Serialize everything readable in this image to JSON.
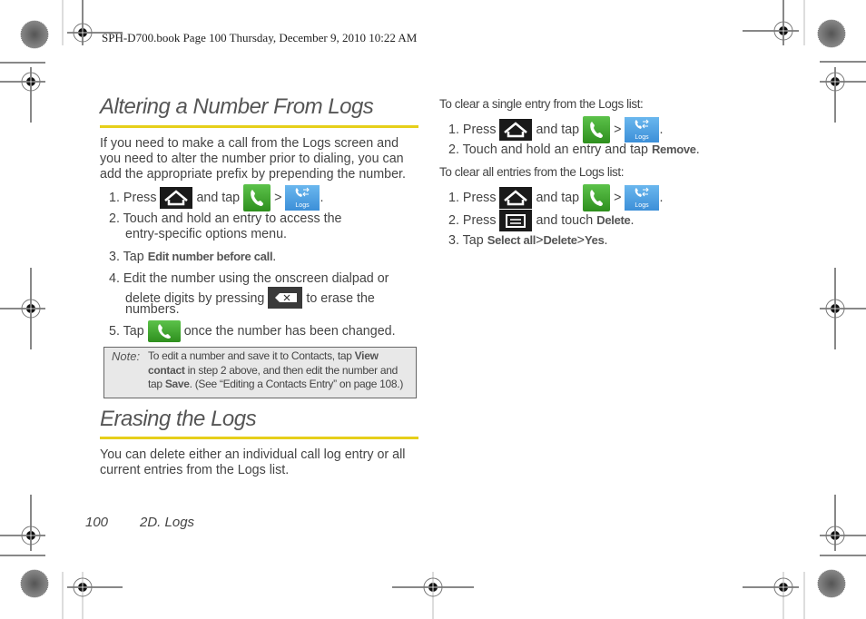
{
  "slug": "SPH-D700.book  Page 100  Thursday, December 9, 2010  10:22 AM",
  "left": {
    "section1": {
      "title": "Altering a Number From Logs",
      "intro": "If you need to make a call from the Logs screen and you need to alter the number prior to dialing, you can add the appropriate prefix by prepending the number.",
      "steps": [
        {
          "num": "1.",
          "pre": "Press",
          "mid": "and tap",
          "sep": ">",
          "end": "."
        },
        {
          "num": "2.",
          "line1": "Touch and hold an entry to access the",
          "line2": "entry-specific options menu."
        },
        {
          "num": "3.",
          "pre": "Tap",
          "bold": "Edit number before call",
          "end": "."
        },
        {
          "num": "4.",
          "line1": "Edit the number using the onscreen dialpad or",
          "line2a": "delete digits by pressing",
          "line2b": "to erase the",
          "line3": "numbers."
        },
        {
          "num": "5.",
          "pre": "Tap",
          "post": "once the number has been changed."
        }
      ],
      "note": {
        "label": "Note:",
        "t1": "To edit a number and save it to Contacts, tap ",
        "b1": "View contact",
        "t2": " in step 2 above, and then edit the number and tap ",
        "b2": "Save",
        "t3": ". (See “Editing a Contacts Entry” on page 108.)"
      }
    },
    "section2": {
      "title": "Erasing the Logs",
      "intro": "You can delete either an individual call log entry or all current entries from the Logs list."
    }
  },
  "right": {
    "single": {
      "heading": "To clear a single entry from the Logs list:",
      "steps": [
        {
          "num": "1.",
          "pre": "Press",
          "mid": "and tap",
          "sep": ">",
          "end": "."
        },
        {
          "num": "2.",
          "pre": "Touch and hold an entry and tap",
          "bold": "Remove",
          "end": "."
        }
      ]
    },
    "all": {
      "heading": "To clear all entries from the Logs list:",
      "steps": [
        {
          "num": "1.",
          "pre": "Press",
          "mid": "and tap",
          "sep": ">",
          "end": "."
        },
        {
          "num": "2.",
          "pre": "Press",
          "mid": "and touch",
          "bold": "Delete",
          "end": "."
        },
        {
          "num": "3.",
          "pre": "Tap",
          "b1": "Select all",
          "sep1": ">",
          "b2": "Delete",
          "sep2": ">",
          "b3": "Yes",
          "end": "."
        }
      ]
    }
  },
  "icons": {
    "logs_label": "Logs"
  },
  "footer": {
    "page": "100",
    "section": "2D. Logs"
  },
  "colors": {
    "rule": "#e6cf1a",
    "phone_green": "#3ea42c",
    "logs_blue": "#4a9be0",
    "note_bg": "#e8e8e8"
  }
}
